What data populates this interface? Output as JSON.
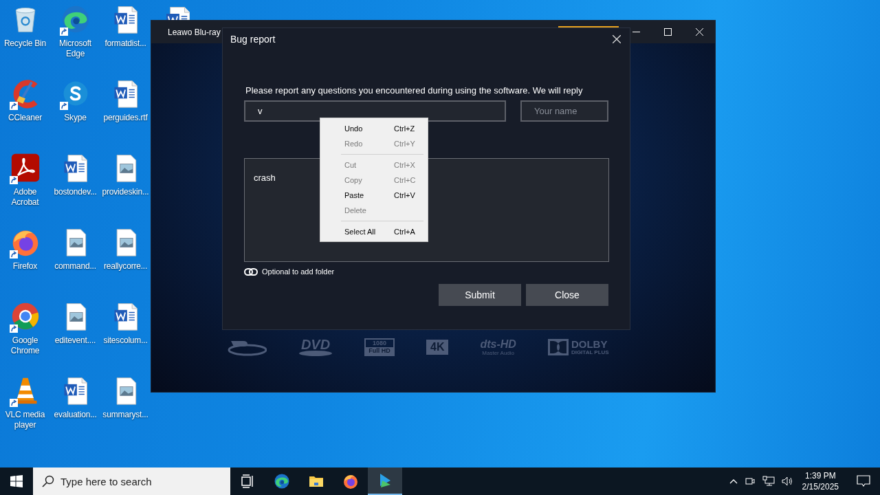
{
  "desktop_icons": [
    {
      "kind": "recycle",
      "label": "Recycle Bin",
      "shortcut": false
    },
    {
      "kind": "ccleaner",
      "label": "CCleaner",
      "shortcut": true
    },
    {
      "kind": "acrobat",
      "label": "Adobe Acrobat",
      "shortcut": true
    },
    {
      "kind": "firefox",
      "label": "Firefox",
      "shortcut": true
    },
    {
      "kind": "chrome",
      "label": "Google Chrome",
      "shortcut": true
    },
    {
      "kind": "vlc",
      "label": "VLC media player",
      "shortcut": true
    },
    {
      "kind": "edge",
      "label": "Microsoft Edge",
      "shortcut": true
    },
    {
      "kind": "skype",
      "label": "Skype",
      "shortcut": true
    },
    {
      "kind": "word",
      "label": "bostondev...",
      "shortcut": false
    },
    {
      "kind": "image",
      "label": "command...",
      "shortcut": false
    },
    {
      "kind": "image",
      "label": "editevent....",
      "shortcut": false
    },
    {
      "kind": "word",
      "label": "evaluation...",
      "shortcut": false
    },
    {
      "kind": "word",
      "label": "formatdist...",
      "shortcut": false
    },
    {
      "kind": "word",
      "label": "perguides.rtf",
      "shortcut": false
    },
    {
      "kind": "image",
      "label": "provideskin...",
      "shortcut": false
    },
    {
      "kind": "image",
      "label": "reallycorre...",
      "shortcut": false
    },
    {
      "kind": "word",
      "label": "sitescolum...",
      "shortcut": false
    },
    {
      "kind": "image",
      "label": "summaryst...",
      "shortcut": false
    },
    {
      "kind": "word",
      "shortcut": false
    }
  ],
  "window": {
    "title": "Leawo Blu-ray",
    "format_logos": [
      {
        "kind": "bluray"
      },
      {
        "kind": "dvd",
        "text": "DVD"
      },
      {
        "kind": "fullhd",
        "text": "1080",
        "subtext": "Full HD"
      },
      {
        "kind": "uhd",
        "text": "4K"
      },
      {
        "kind": "dts",
        "text": "dts-HD",
        "subtext": "Master Audio"
      },
      {
        "kind": "dolby",
        "text": "DOLBY",
        "subtext": "DIGITAL PLUS"
      }
    ]
  },
  "dialog": {
    "title": "Bug report",
    "instruction": "Please report any questions you encountered during using the software. We will reply",
    "email_field": {
      "value": "v"
    },
    "name_field": {
      "placeholder": "Your name"
    },
    "message_field": {
      "value": "crash"
    },
    "attach_link": "Optional to add folder",
    "buttons": [
      "Submit",
      "Close"
    ],
    "context_menu": {
      "items": [
        {
          "kind": "item",
          "label": "Undo",
          "shortcut": "Ctrl+Z",
          "disabled": false
        },
        {
          "kind": "item",
          "label": "Redo",
          "shortcut": "Ctrl+Y",
          "disabled": true
        },
        {
          "kind": "separator"
        },
        {
          "kind": "item",
          "label": "Cut",
          "shortcut": "Ctrl+X",
          "disabled": true
        },
        {
          "kind": "item",
          "label": "Copy",
          "shortcut": "Ctrl+C",
          "disabled": true
        },
        {
          "kind": "item",
          "label": "Paste",
          "shortcut": "Ctrl+V",
          "disabled": false
        },
        {
          "kind": "item",
          "label": "Delete",
          "disabled": true
        },
        {
          "kind": "separator"
        },
        {
          "kind": "item",
          "label": "Select All",
          "shortcut": "Ctrl+A",
          "disabled": false
        }
      ]
    }
  },
  "taskbar": {
    "search": {
      "placeholder": "Type here to search"
    },
    "apps": [
      {
        "kind": "taskview",
        "active": false
      },
      {
        "kind": "edge",
        "active": false
      },
      {
        "kind": "explorer",
        "active": false
      },
      {
        "kind": "firefox",
        "active": false
      },
      {
        "kind": "leawo",
        "active": true
      }
    ],
    "time": "1:39 PM",
    "date": "2/15/2025"
  }
}
